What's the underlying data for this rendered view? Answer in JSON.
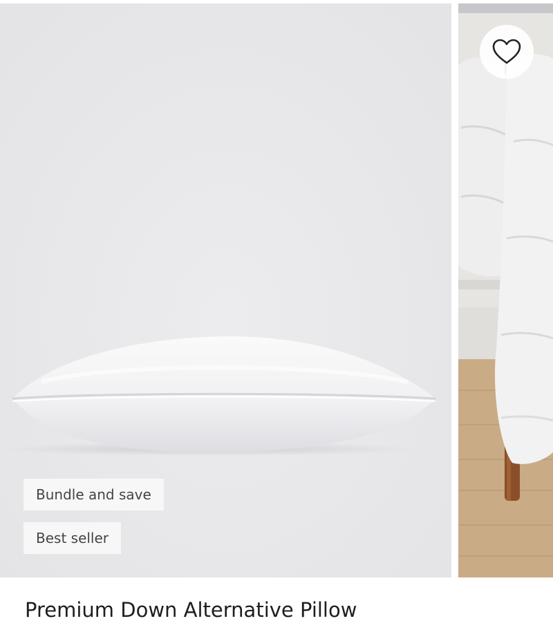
{
  "product": {
    "title": "Premium Down Alternative Pillow",
    "badges": [
      "Bundle and save",
      "Best seller"
    ]
  },
  "gallery": {
    "main_image": "pillow-photo",
    "next_image": "down-comforter-on-bed-photo"
  },
  "wishlist": {
    "icon": "heart-outline-icon"
  },
  "colors": {
    "image_background": "#e8e8ea",
    "badge_background": "#f7f7f7",
    "badge_text": "#444444",
    "title_text": "#1e1e1e"
  }
}
